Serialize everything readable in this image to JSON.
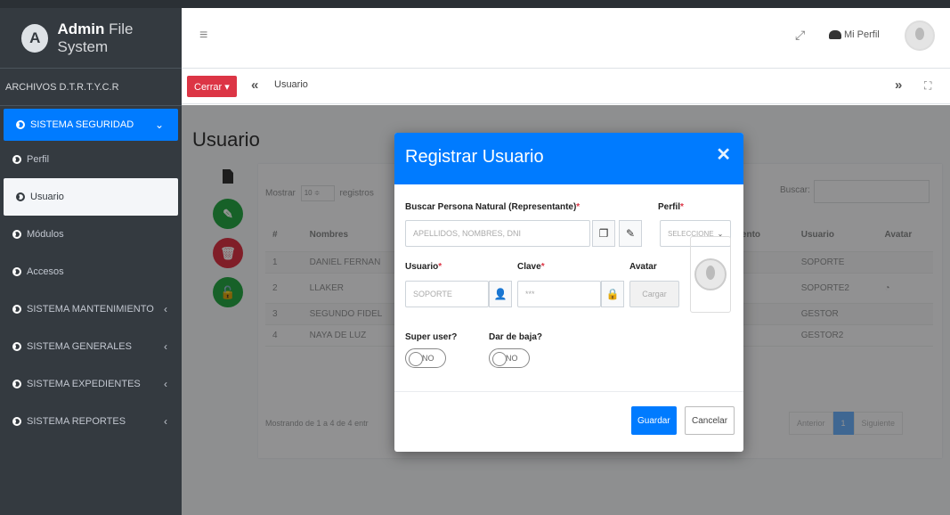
{
  "brand": {
    "logo_letter": "A",
    "name_bold": "Admin",
    "name_rest": " File System"
  },
  "sidebar": {
    "user_label": "ARCHIVOS D.T.R.T.Y.C.R",
    "items": [
      {
        "label": "SISTEMA SEGURIDAD",
        "arrow": "⌄"
      },
      {
        "label": "Perfil"
      },
      {
        "label": "Usuario"
      },
      {
        "label": "Módulos"
      },
      {
        "label": "Accesos"
      },
      {
        "label": "SISTEMA MANTENIMIENTO",
        "arrow": "‹"
      },
      {
        "label": "SISTEMA GENERALES",
        "arrow": "‹"
      },
      {
        "label": "SISTEMA EXPEDIENTES",
        "arrow": "‹"
      },
      {
        "label": "SISTEMA REPORTES",
        "arrow": "‹"
      }
    ]
  },
  "header": {
    "menu_icon": "≡",
    "expand_icon": "⤢",
    "profile_label": "Mi Perfil"
  },
  "tabbar": {
    "close_label": "Cerrar ▾",
    "prev": "«",
    "tab_label": "Usuario",
    "next": "»",
    "fullscreen_icon": "⛶"
  },
  "page": {
    "title": "Usuario",
    "show_label": "Mostrar",
    "show_value": "10 ≑",
    "records_label": "registros",
    "search_label": "Buscar:",
    "columns": [
      "#",
      "Nombres",
      "",
      "nento",
      "Usuario",
      "Avatar"
    ],
    "rows": [
      {
        "n": "1",
        "name": "DANIEL FERNAN",
        "user": "SOPORTE"
      },
      {
        "n": "2",
        "name": "LLAKER",
        "user": "SOPORTE2"
      },
      {
        "n": "3",
        "name": "SEGUNDO FIDEL",
        "user": "GESTOR"
      },
      {
        "n": "4",
        "name": "NAYA DE LUZ",
        "user": "GESTOR2"
      }
    ],
    "footer_info": "Mostrando de 1 a 4 de 4 entr",
    "pager": {
      "prev": "Anterior",
      "current": "1",
      "next": "Siguiente"
    }
  },
  "modal": {
    "title": "Registrar Usuario",
    "close": "✕",
    "search_person_label": "Buscar Persona Natural (Representante)",
    "search_person_placeholder": "APELLIDOS, NOMBRES, DNI",
    "perfil_label": "Perfil",
    "perfil_value": "SELECCIONE",
    "usuario_label": "Usuario",
    "usuario_placeholder": "SOPORTE",
    "clave_label": "Clave",
    "clave_placeholder": "***",
    "avatar_label": "Avatar",
    "cargar_label": "Cargar",
    "superuser_label": "Super user?",
    "superuser_toggle": "NO",
    "baja_label": "Dar de baja?",
    "baja_toggle": "NO",
    "save_label": "Guardar",
    "cancel_label": "Cancelar",
    "required_mark": "*"
  },
  "colors": {
    "primary": "#007bff",
    "danger": "#dc3545",
    "success": "#28a745",
    "sidebar": "#343a40"
  }
}
